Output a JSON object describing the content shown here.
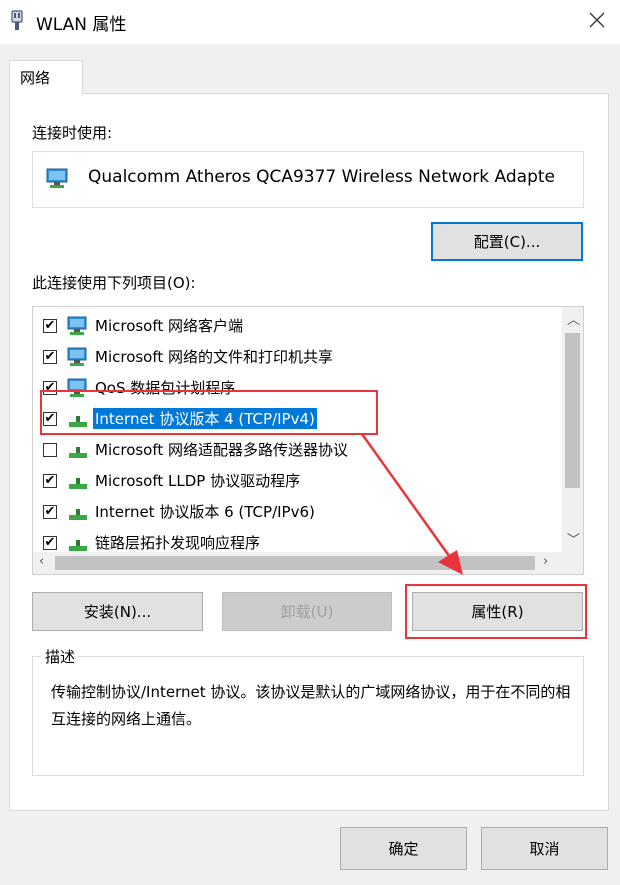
{
  "window": {
    "title": "WLAN 属性",
    "title_icon": "wlan-adapter-icon",
    "close_icon": "close-icon"
  },
  "tabs": [
    {
      "label": "网络"
    }
  ],
  "connect_using": {
    "label": "连接时使用:",
    "adapter_name": "Qualcomm Atheros QCA9377 Wireless Network Adapte",
    "configure_label": "配置(C)..."
  },
  "items_section": {
    "label": "此连接使用下列项目(O):",
    "items": [
      {
        "label": "Microsoft 网络客户端",
        "checked": "✔",
        "icon": "network-client-icon"
      },
      {
        "label": "Microsoft 网络的文件和打印机共享",
        "checked": "✔",
        "icon": "network-client-icon"
      },
      {
        "label": "QoS 数据包计划程序",
        "checked": "✔",
        "icon": "network-client-icon"
      },
      {
        "label": "Internet 协议版本 4 (TCP/IPv4)",
        "checked": "✔",
        "icon": "protocol-icon"
      },
      {
        "label": "Microsoft 网络适配器多路传送器协议",
        "checked": "",
        "icon": "protocol-icon"
      },
      {
        "label": "Microsoft LLDP 协议驱动程序",
        "checked": "✔",
        "icon": "protocol-icon"
      },
      {
        "label": "Internet 协议版本 6 (TCP/IPv6)",
        "checked": "✔",
        "icon": "protocol-icon"
      },
      {
        "label": "链路层拓扑发现响应程序",
        "checked": "✔",
        "icon": "protocol-icon"
      }
    ],
    "selected_index": 3
  },
  "buttons": {
    "install": "安装(N)...",
    "uninstall": "卸载(U)",
    "properties": "属性(R)"
  },
  "description": {
    "label": "描述",
    "text": "传输控制协议/Internet 协议。该协议是默认的广域网络协议，用于在不同的相互连接的网络上通信。"
  },
  "footer": {
    "ok": "确定",
    "cancel": "取消"
  },
  "colors": {
    "selection": "#0078d7",
    "annotation": "#e8343a"
  }
}
